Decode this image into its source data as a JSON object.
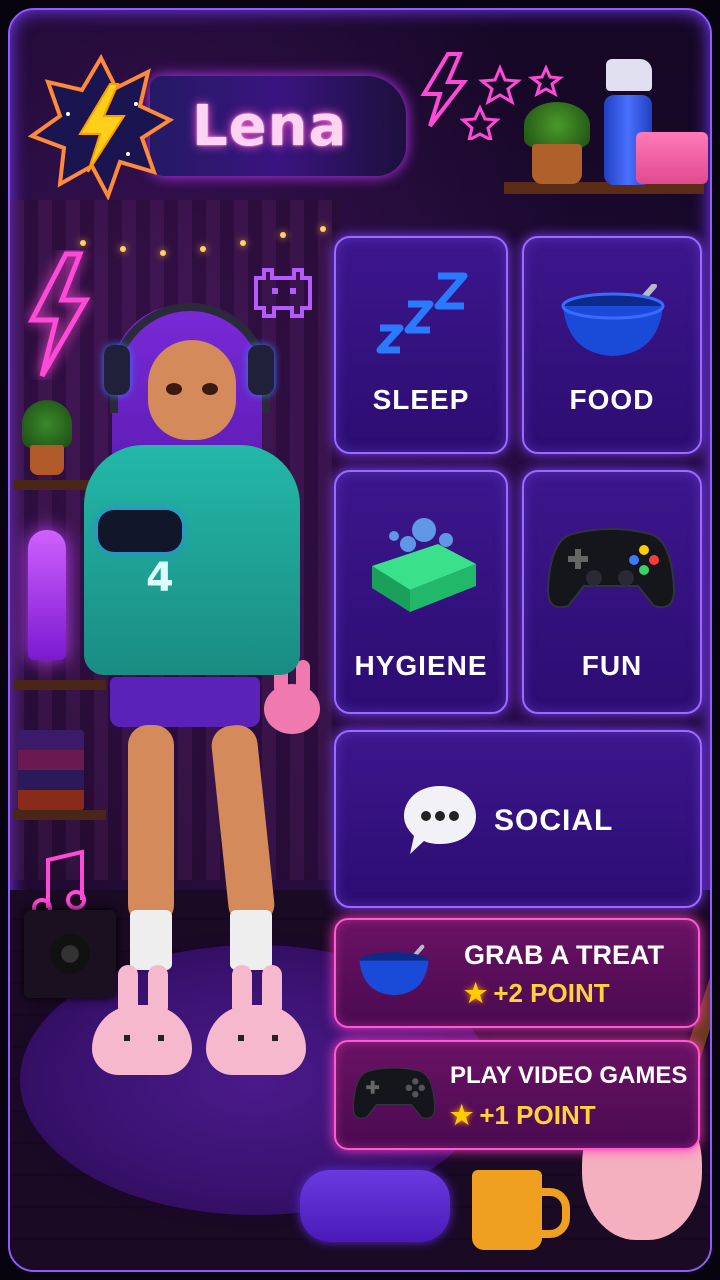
{
  "player": {
    "name": "Lena"
  },
  "needs": [
    {
      "id": "sleep",
      "label": "SLEEP",
      "icon": "zzz-icon"
    },
    {
      "id": "food",
      "label": "FOOD",
      "icon": "bowl-icon"
    },
    {
      "id": "hygiene",
      "label": "HYGIENE",
      "icon": "soap-icon"
    },
    {
      "id": "fun",
      "label": "FUN",
      "icon": "gamepad-icon"
    },
    {
      "id": "social",
      "label": "SOCIAL",
      "icon": "speech-bubble-icon"
    }
  ],
  "actions": [
    {
      "label": "GRAB A TREAT",
      "points": "+2 POINT",
      "icon": "bowl-icon"
    },
    {
      "label": "PLAY VIDEO GAMES",
      "points": "+1 POINT",
      "icon": "gamepad-icon"
    }
  ],
  "colors": {
    "accent": "#9a6bff",
    "action": "#ff5ad0",
    "points": "#ffd23a"
  }
}
